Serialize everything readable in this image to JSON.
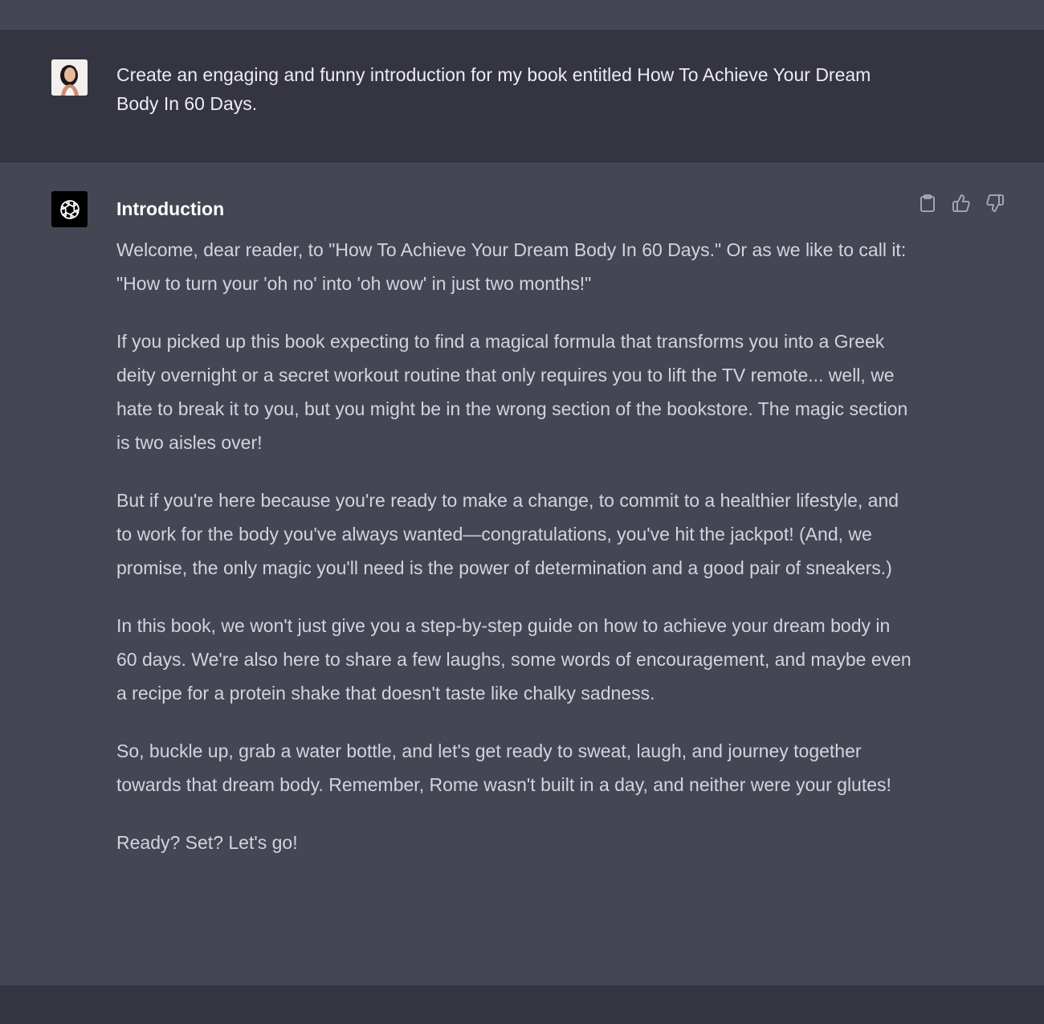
{
  "user_message": {
    "text": "Create an engaging and funny introduction for my book entitled How To Achieve Your Dream Body In 60 Days."
  },
  "assistant_message": {
    "heading": "Introduction",
    "paragraphs": [
      "Welcome, dear reader, to \"How To Achieve Your Dream Body In 60 Days.\" Or as we like to call it: \"How to turn your 'oh no' into 'oh wow' in just two months!\"",
      "If you picked up this book expecting to find a magical formula that transforms you into a Greek deity overnight or a secret workout routine that only requires you to lift the TV remote... well, we hate to break it to you, but you might be in the wrong section of the bookstore. The magic section is two aisles over!",
      "But if you're here because you're ready to make a change, to commit to a healthier lifestyle, and to work for the body you've always wanted—congratulations, you've hit the jackpot! (And, we promise, the only magic you'll need is the power of determination and a good pair of sneakers.)",
      "In this book, we won't just give you a step-by-step guide on how to achieve your dream body in 60 days. We're also here to share a few laughs, some words of encouragement, and maybe even a recipe for a protein shake that doesn't taste like chalky sadness.",
      "So, buckle up, grab a water bottle, and let's get ready to sweat, laugh, and journey together towards that dream body. Remember, Rome wasn't built in a day, and neither were your glutes!",
      "Ready? Set? Let's go!"
    ]
  },
  "icons": {
    "copy": "clipboard-icon",
    "like": "thumbs-up-icon",
    "dislike": "thumbs-down-icon",
    "bot": "openai-logo-icon",
    "user": "user-avatar"
  },
  "colors": {
    "user_row_bg": "#343541",
    "assistant_row_bg": "#444654",
    "text": "#d1d5db"
  }
}
